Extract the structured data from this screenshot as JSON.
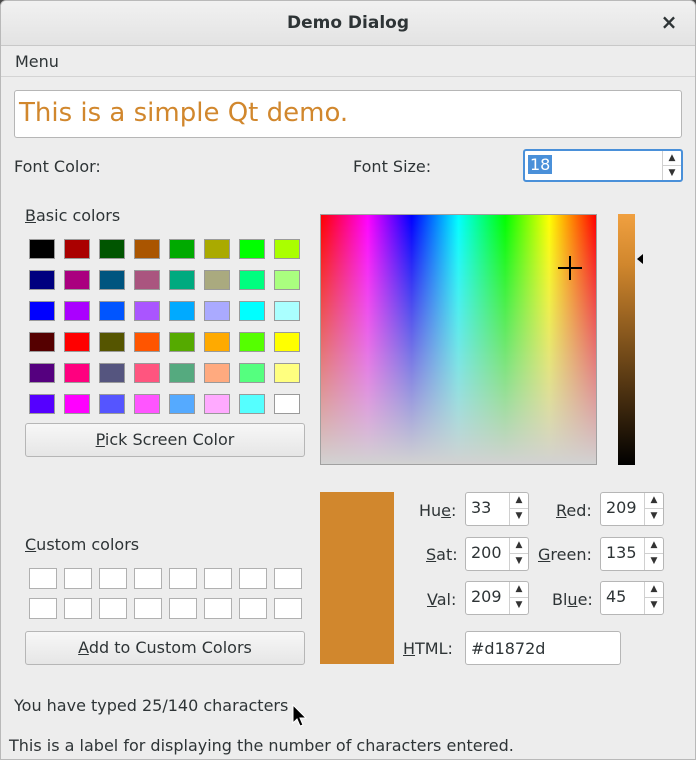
{
  "window": {
    "title": "Demo Dialog",
    "close_glyph": "×"
  },
  "menu": {
    "label": "Menu"
  },
  "text_input": {
    "value": "This is a simple Qt demo.",
    "color": "#d1872d"
  },
  "font_color_label": "Font Color:",
  "font_size": {
    "label": "Font Size:",
    "value": "18"
  },
  "basic_colors": {
    "label_first": "B",
    "label_rest": "asic colors",
    "swatches": [
      "#000000",
      "#aa0000",
      "#005500",
      "#aa5500",
      "#00aa00",
      "#aaaa00",
      "#00ff00",
      "#aaff00",
      "#00007f",
      "#aa007f",
      "#00557f",
      "#aa557f",
      "#00aa7f",
      "#aaaa7f",
      "#00ff7f",
      "#aaff7f",
      "#0000ff",
      "#aa00ff",
      "#0055ff",
      "#aa55ff",
      "#00aaff",
      "#aaaaff",
      "#00ffff",
      "#aaffff",
      "#550000",
      "#ff0000",
      "#555500",
      "#ff5500",
      "#55aa00",
      "#ffaa00",
      "#55ff00",
      "#ffff00",
      "#55007f",
      "#ff007f",
      "#55557f",
      "#ff557f",
      "#55aa7f",
      "#ffaa7f",
      "#55ff7f",
      "#ffff7f",
      "#5500ff",
      "#ff00ff",
      "#5555ff",
      "#ff55ff",
      "#55aaff",
      "#ffaaff",
      "#55ffff",
      "#ffffff"
    ]
  },
  "pick_screen_color": {
    "first": "P",
    "rest": "ick Screen Color"
  },
  "custom_colors": {
    "label_first": "C",
    "label_rest": "ustom colors"
  },
  "add_custom": {
    "first": "A",
    "rest": "dd to Custom Colors"
  },
  "current_color": "#d1872d",
  "fields": {
    "hue": {
      "label_a": "Hu",
      "label_u": "e",
      "label_b": ":",
      "value": "33"
    },
    "sat": {
      "label_a": "",
      "label_u": "S",
      "label_b": "at:",
      "value": "200"
    },
    "val": {
      "label_a": "",
      "label_u": "V",
      "label_b": "al:",
      "value": "209"
    },
    "red": {
      "label_a": "",
      "label_u": "R",
      "label_b": "ed:",
      "value": "209"
    },
    "green": {
      "label_a": "",
      "label_u": "G",
      "label_b": "reen:",
      "value": "135"
    },
    "blue": {
      "label_a": "Bl",
      "label_u": "u",
      "label_b": "e:",
      "value": "45"
    },
    "html": {
      "label_a": "",
      "label_u": "H",
      "label_b": "TML:",
      "value": "#d1872d"
    }
  },
  "status": {
    "typed": "You have typed 25/140 characters",
    "description": "This is a label for displaying the number of characters entered."
  },
  "icons": {
    "spin_up": "▲",
    "spin_down": "▼",
    "pointer": "mouse-pointer-icon"
  }
}
